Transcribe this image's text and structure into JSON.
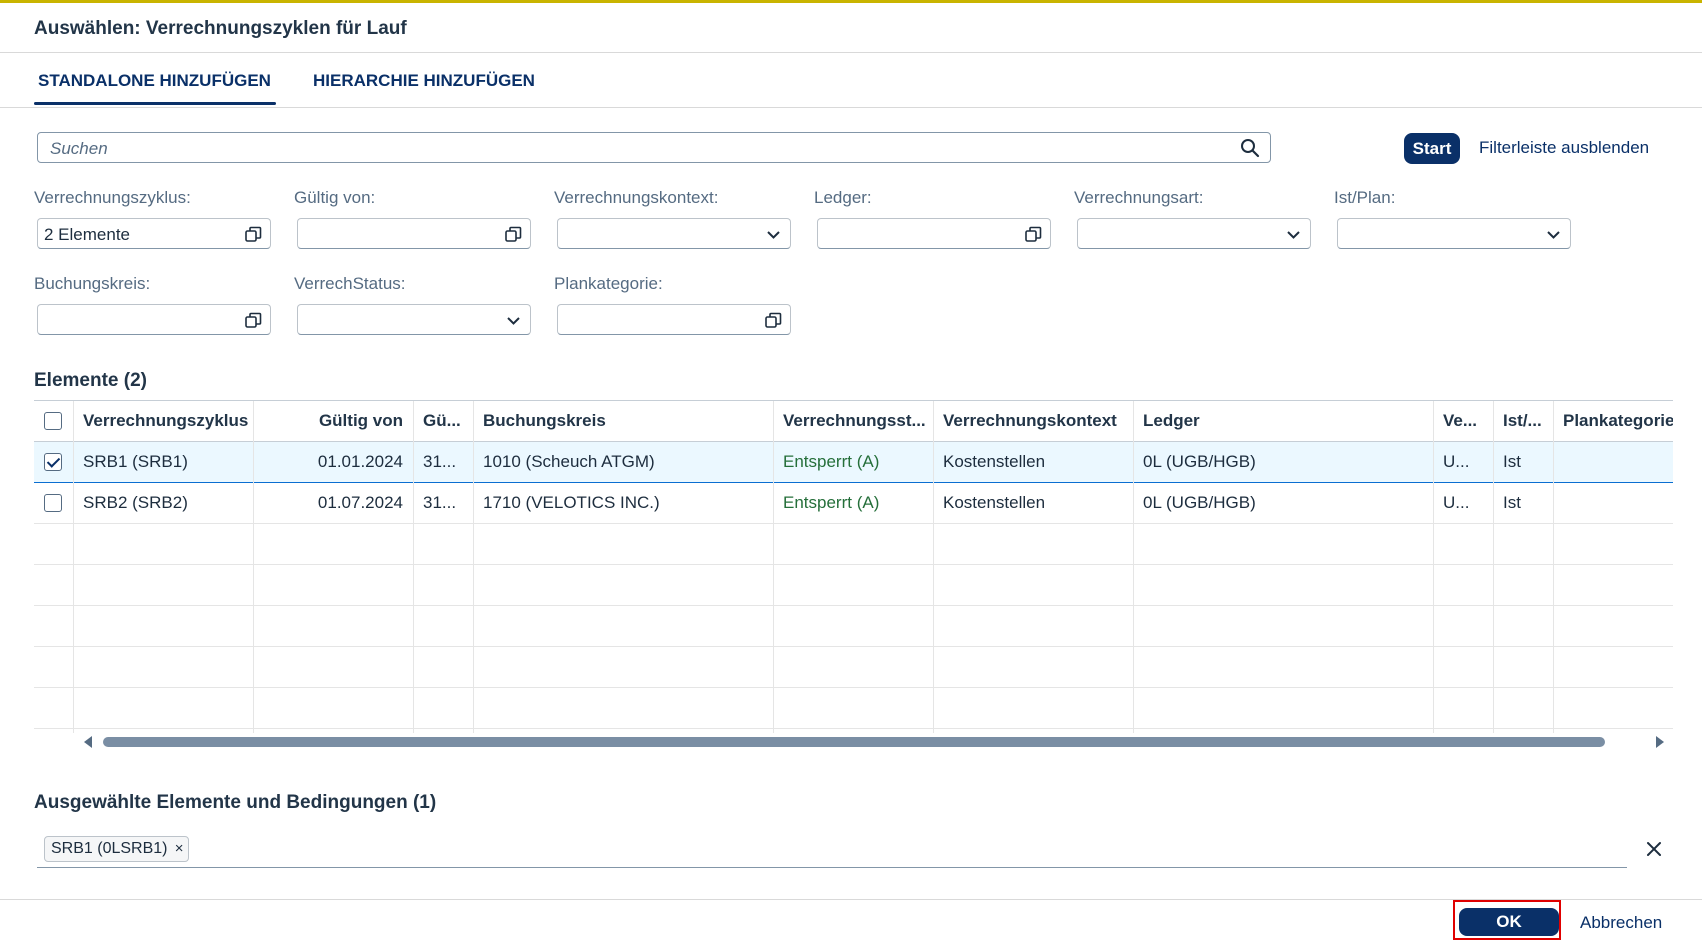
{
  "dialog": {
    "title": "Auswählen: Verrechnungszyklen für Lauf"
  },
  "tabs": [
    {
      "label": "STANDALONE HINZUFÜGEN",
      "active": true
    },
    {
      "label": "HIERARCHIE HINZUFÜGEN",
      "active": false
    }
  ],
  "search": {
    "placeholder": "Suchen",
    "value": ""
  },
  "filterbar": {
    "start_label": "Start",
    "toggle_label": "Filterleiste ausblenden",
    "fields": [
      {
        "label": "Verrechnungszyklus:",
        "value": "2 Elemente",
        "icon": "value-help-icon"
      },
      {
        "label": "Gültig von:",
        "value": "",
        "icon": "value-help-icon"
      },
      {
        "label": "Verrechnungskontext:",
        "value": "",
        "icon": "chevron-down-icon"
      },
      {
        "label": "Ledger:",
        "value": "",
        "icon": "value-help-icon"
      },
      {
        "label": "Verrechnungsart:",
        "value": "",
        "icon": "chevron-down-icon"
      },
      {
        "label": "Ist/Plan:",
        "value": "",
        "icon": "chevron-down-icon"
      },
      {
        "label": "Buchungskreis:",
        "value": "",
        "icon": "value-help-icon"
      },
      {
        "label": "VerrechStatus:",
        "value": "",
        "icon": "chevron-down-icon"
      },
      {
        "label": "Plankategorie:",
        "value": "",
        "icon": "value-help-icon"
      }
    ]
  },
  "table": {
    "title": "Elemente (2)",
    "columns": [
      "Verrechnungszyklus",
      "Gültig von",
      "Gü...",
      "Buchungskreis",
      "Verrechnungsst...",
      "Verrechnungskontext",
      "Ledger",
      "Ve...",
      "Ist/...",
      "Plankategorie"
    ],
    "rows": [
      {
        "selected": true,
        "cells": [
          "SRB1 (SRB1)",
          "01.01.2024",
          "31...",
          "1010 (Scheuch ATGM)",
          "Entsperrt (A)",
          "Kostenstellen",
          "0L (UGB/HGB)",
          "U...",
          "Ist",
          ""
        ]
      },
      {
        "selected": false,
        "cells": [
          "SRB2 (SRB2)",
          "01.07.2024",
          "31...",
          "1710 (VELOTICS INC.)",
          "Entsperrt (A)",
          "Kostenstellen",
          "0L (UGB/HGB)",
          "U...",
          "Ist",
          ""
        ]
      }
    ],
    "status_color": "#256f3a"
  },
  "selected_section": {
    "title": "Ausgewählte Elemente und Bedingungen (1)",
    "tokens": [
      "SRB1 (0LSRB1)"
    ],
    "token_remove": "×"
  },
  "footer": {
    "ok_label": "OK",
    "cancel_label": "Abbrechen"
  },
  "colors": {
    "brand": "#0a3068",
    "selected_row": "#ebf8ff",
    "focus_outline": "#e00000"
  }
}
